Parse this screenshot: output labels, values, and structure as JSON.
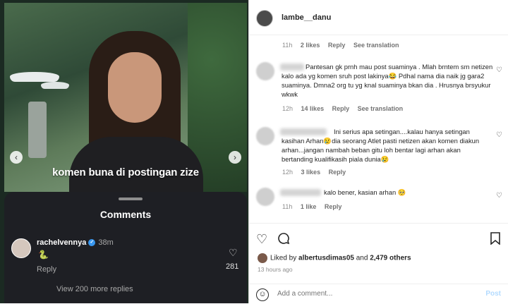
{
  "media": {
    "caption": "komen buna di postingan zize",
    "prev_arrow": "‹",
    "next_arrow": "›",
    "sheet": {
      "title": "Comments",
      "comment": {
        "username": "rachelvennya",
        "time": "38m",
        "emoji": "🐍",
        "reply": "Reply",
        "likes": "281"
      },
      "view_more": "View 200 more replies"
    }
  },
  "header": {
    "username": "lambe__danu"
  },
  "top_meta": {
    "time": "11h",
    "likes": "2 likes",
    "reply": "Reply",
    "translate": "See translation"
  },
  "comments": [
    {
      "text": "Pantesan gk prnh mau post suaminya . Mlah brntem sm netizen kalo ada yg komen sruh post lakinya😂 Pdhal nama dia naik jg gara2 suaminya. Dmna2 org tu yg knal suaminya bkan dia . Hrusnya brsyukur wkwk",
      "time": "12h",
      "likes": "14 likes",
      "reply": "Reply",
      "translate": "See translation"
    },
    {
      "text": "Ini serius apa setingan....kalau hanya setingan kasihan Arhan😢dia seorang Atlet pasti netizen akan komen diakun arhan...jangan nambah beban gitu loh bentar lagi arhan akan bertanding kualifikasih piala dunia😢",
      "time": "12h",
      "likes": "3 likes",
      "reply": "Reply"
    },
    {
      "text": "kalo bener, kasian arhan 🥺",
      "time": "11h",
      "likes": "1 like",
      "reply": "Reply"
    }
  ],
  "actions": {
    "liked_prefix": "Liked by",
    "liked_user": "albertusdimas05",
    "liked_and": "and",
    "liked_others": "2,479 others",
    "ago": "13 hours ago",
    "add_placeholder": "Add a comment...",
    "post": "Post"
  }
}
